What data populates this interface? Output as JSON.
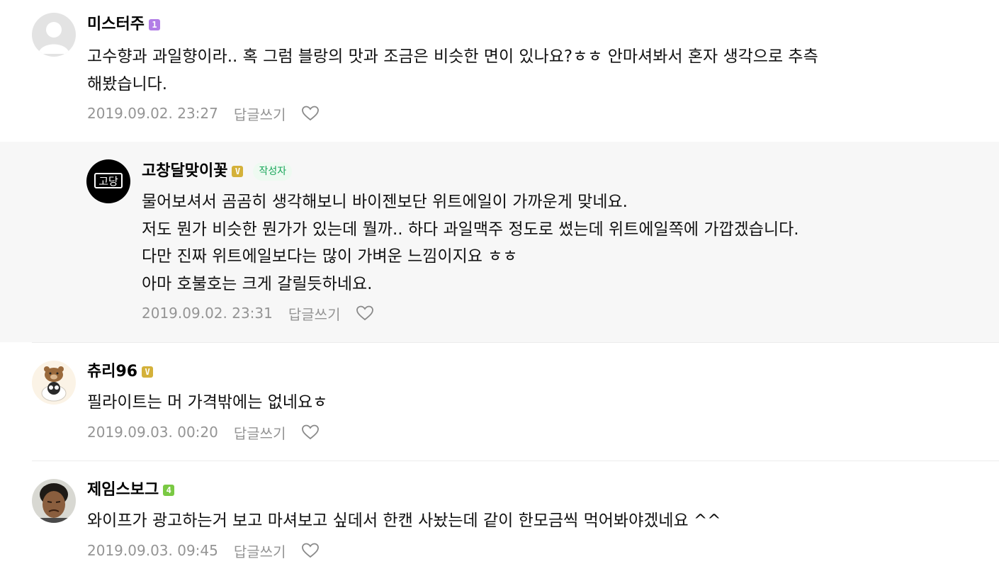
{
  "comments": [
    {
      "author": "미스터주",
      "level": "1",
      "level_color": "#b27ee6",
      "lines": [
        "고수향과 과일향이라.. 혹 그럼 블랑의 맛과 조금은 비슷한 면이 있나요?ㅎㅎ 안마셔봐서 혼자 생각으로 추측",
        "해봤습니다."
      ],
      "date": "2019.09.02. 23:27",
      "reply_label": "답글쓰기",
      "avatar_icon": "default-avatar-icon"
    },
    {
      "author": "고창달맞이꽃",
      "level": "V",
      "level_color": "#d4b13a",
      "writer_badge": "작성자",
      "lines": [
        "물어보셔서 곰곰히 생각해보니 바이젠보단 위트에일이 가까운게 맞네요.",
        "저도 뭔가 비슷한 뭔가가 있는데 뭘까.. 하다 과일맥주 정도로 썼는데 위트에일쪽에 가깝겠습니다.",
        "다만 진짜 위트에일보다는 많이 가벼운 느낌이지요 ㅎㅎ",
        "아마 호불호는 크게 갈릴듯하네요."
      ],
      "date": "2019.09.02. 23:31",
      "reply_label": "답글쓰기",
      "avatar_icon": "brand-logo-avatar",
      "avatar_text": "고당"
    },
    {
      "author": "츄리96",
      "level": "V",
      "level_color": "#d4b13a",
      "lines": [
        "필라이트는 머 가격밖에는 없네요ㅎ"
      ],
      "date": "2019.09.03. 00:20",
      "reply_label": "답글쓰기",
      "avatar_icon": "bear-avatar"
    },
    {
      "author": "제임스보그",
      "level": "4",
      "level_color": "#7ac943",
      "lines": [
        "와이프가 광고하는거 보고 마셔보고 싶데서 한캔 사놨는데 같이 한모금씩 먹어봐야겠네요 ^^"
      ],
      "date": "2019.09.03. 09:45",
      "reply_label": "답글쓰기",
      "avatar_icon": "photo-avatar"
    }
  ]
}
